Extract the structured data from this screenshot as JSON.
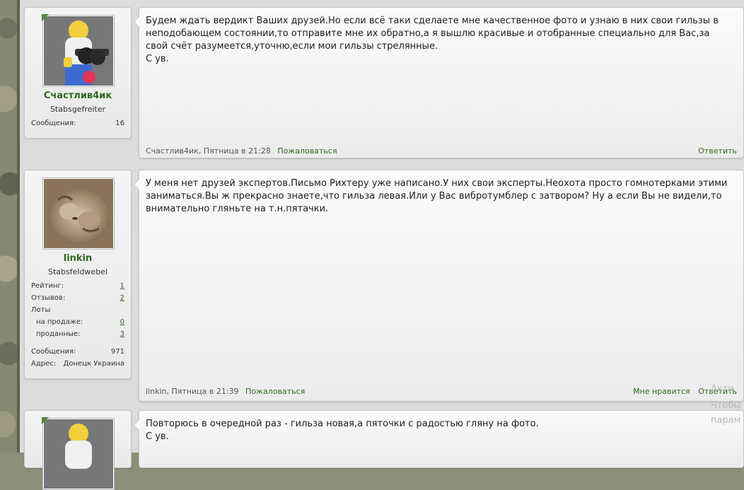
{
  "posts": [
    {
      "username": "Счастлив4ик",
      "user_title": "Stabsgefreiter",
      "messages_label": "Сообщения:",
      "messages_count": "16",
      "text": [
        "Будем ждать вердикт Ваших друзей.Но если всё таки сделаете мне качественное фото и узнаю в них свои гильзы в",
        "неподобающем состоянии,то отправите мне их обратно,а я вышлю красивые и отобранные специально для Вас,за",
        "свой счёт разумеется,уточню,если мои гильзы стрелянные.",
        "С ув."
      ],
      "meta": "Счастлив4ик, Пятница в 21:28",
      "report": "Пожаловаться",
      "reply": "Ответить"
    },
    {
      "username": "linkin",
      "user_title": "Stabsfeldwebel",
      "rating_label": "Рейтинг:",
      "rating_value": "1",
      "reviews_label": "Отзывов:",
      "reviews_value": "2",
      "lots_label": "Лоты",
      "on_sale_label": "на продаже:",
      "on_sale_value": "0",
      "sold_label": "проданные:",
      "sold_value": "3",
      "messages_label": "Сообщения:",
      "messages_count": "971",
      "address_label": "Адрес:",
      "address_value": "Донецк Украина",
      "text": [
        "У меня нет друзей экспертов.Письмо Рихтеру уже написано.У них свои эксперты.Неохота просто гомнотерками этими",
        "заниматься.Вы ж прекрасно знаете,что гильза левая.Или у Вас вибротумблер с затвором? Ну а если Вы не видели,то",
        "внимательно гляньте на т.н.пятачки."
      ],
      "meta": "linkin, Пятница в 21:39",
      "report": "Пожаловаться",
      "like": "Мне нравится",
      "reply": "Ответить"
    },
    {
      "text": [
        "Повторюсь в очередной раз - гильза новая,а пяточки с радостью гляну на фото.",
        "С ув."
      ]
    }
  ],
  "watermark": {
    "line1": "Акти",
    "line2": "Чтобы",
    "line3": "парам"
  }
}
